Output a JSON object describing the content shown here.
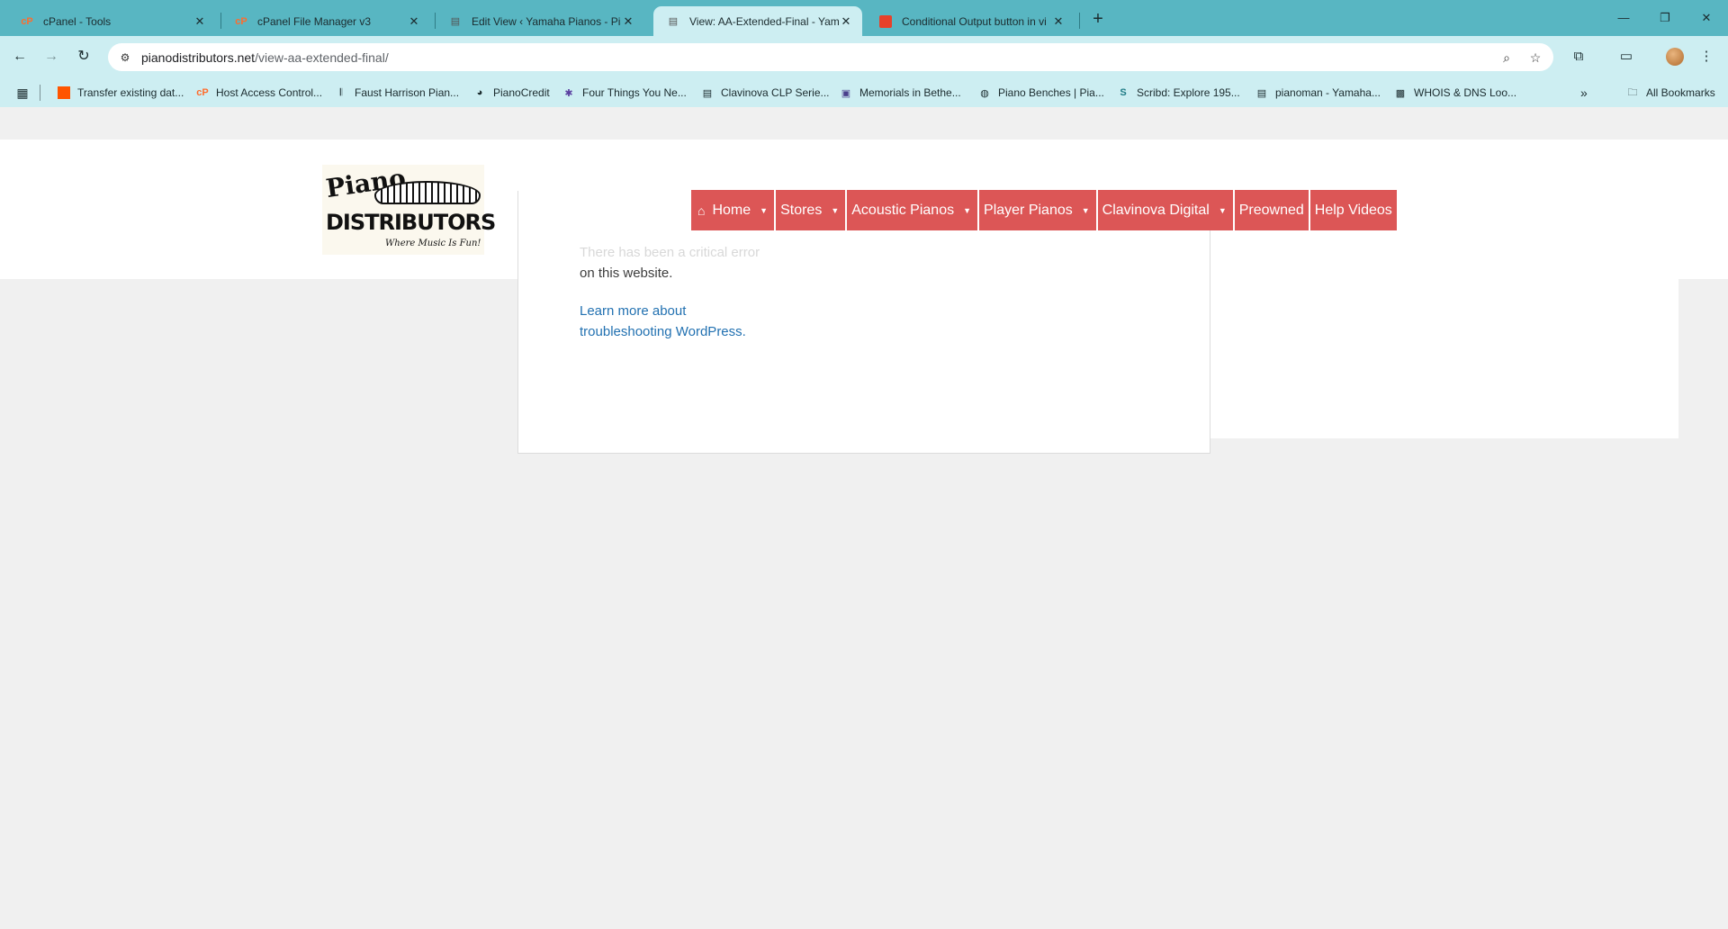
{
  "browser": {
    "tabs": [
      {
        "title": "cPanel - Tools",
        "icon": "cpanel-icon",
        "active": false
      },
      {
        "title": "cPanel File Manager v3",
        "icon": "cpanel-icon",
        "active": false
      },
      {
        "title": "Edit View ‹ Yamaha Pianos - Pia",
        "icon": "piano-site-icon",
        "active": false
      },
      {
        "title": "View: AA-Extended-Final - Yam",
        "icon": "piano-site-icon",
        "active": true
      },
      {
        "title": "Conditional Output button in vi",
        "icon": "red-square-icon",
        "active": false
      }
    ],
    "url_host": "pianodistributors.net",
    "url_path": "/view-aa-extended-final/",
    "bookmarks": [
      "Transfer existing dat...",
      "Host Access Control...",
      "Faust Harrison Pian...",
      "PianoCredit",
      "Four Things You Ne...",
      "Clavinova CLP Serie...",
      "Memorials in Bethe...",
      "Piano Benches | Pia...",
      "Scribd: Explore 195...",
      "pianoman - Yamaha...",
      "WHOIS & DNS Loo..."
    ],
    "all_bookmarks": "All Bookmarks"
  },
  "site": {
    "logo": {
      "word1": "Piano",
      "word2": "DISTRIBUTORS",
      "tagline": "Where Music Is Fun!"
    },
    "menu": [
      {
        "label": "Home",
        "has_dropdown": true
      },
      {
        "label": "Stores",
        "has_dropdown": true
      },
      {
        "label": "Acoustic Pianos",
        "has_dropdown": true
      },
      {
        "label": "Player Pianos",
        "has_dropdown": true
      },
      {
        "label": "Clavinova Digital",
        "has_dropdown": true
      },
      {
        "label": "Preowned",
        "has_dropdown": false
      },
      {
        "label": "Help Videos",
        "has_dropdown": false
      }
    ],
    "error": {
      "line1": "There has been a critical error",
      "line2": "on this website.",
      "link_line1": "Learn more about",
      "link_line2": "troubleshooting WordPress."
    }
  },
  "colors": {
    "tabstrip": "#58b6c2",
    "toolbar": "#cdeef2",
    "menu_accent": "#dc5656",
    "link": "#2271b1"
  }
}
